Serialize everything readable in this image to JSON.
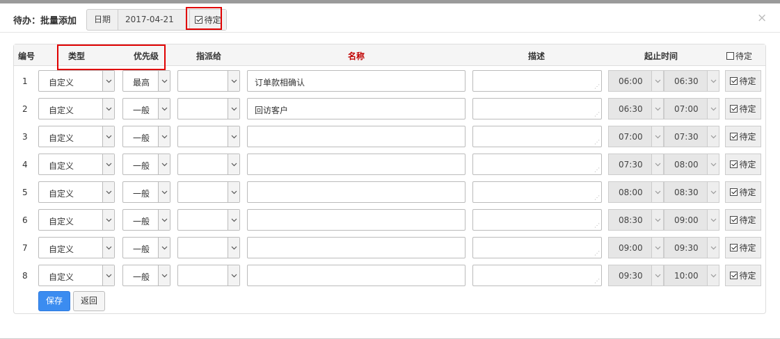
{
  "dialog": {
    "title": "待办：批量添加",
    "close": "×",
    "date_label": "日期",
    "date_value": "2017-04-21",
    "pending_label": "待定",
    "pending_checked": true
  },
  "table": {
    "headers": {
      "num": "编号",
      "type": "类型",
      "priority": "优先级",
      "assign": "指派给",
      "name": "名称",
      "desc": "描述",
      "time": "起止时间",
      "pending": "待定"
    },
    "rows": [
      {
        "num": "1",
        "type": "自定义",
        "priority": "最高",
        "assign": "",
        "name": "订单款相确认",
        "desc": "",
        "start": "06:00",
        "end": "06:30",
        "pending": "待定"
      },
      {
        "num": "2",
        "type": "自定义",
        "priority": "一般",
        "assign": "",
        "name": "回访客户",
        "desc": "",
        "start": "06:30",
        "end": "07:00",
        "pending": "待定"
      },
      {
        "num": "3",
        "type": "自定义",
        "priority": "一般",
        "assign": "",
        "name": "",
        "desc": "",
        "start": "07:00",
        "end": "07:30",
        "pending": "待定"
      },
      {
        "num": "4",
        "type": "自定义",
        "priority": "一般",
        "assign": "",
        "name": "",
        "desc": "",
        "start": "07:30",
        "end": "08:00",
        "pending": "待定"
      },
      {
        "num": "5",
        "type": "自定义",
        "priority": "一般",
        "assign": "",
        "name": "",
        "desc": "",
        "start": "08:00",
        "end": "08:30",
        "pending": "待定"
      },
      {
        "num": "6",
        "type": "自定义",
        "priority": "一般",
        "assign": "",
        "name": "",
        "desc": "",
        "start": "08:30",
        "end": "09:00",
        "pending": "待定"
      },
      {
        "num": "7",
        "type": "自定义",
        "priority": "一般",
        "assign": "",
        "name": "",
        "desc": "",
        "start": "09:00",
        "end": "09:30",
        "pending": "待定"
      },
      {
        "num": "8",
        "type": "自定义",
        "priority": "一般",
        "assign": "",
        "name": "",
        "desc": "",
        "start": "09:30",
        "end": "10:00",
        "pending": "待定"
      }
    ]
  },
  "buttons": {
    "save": "保存",
    "back": "返回"
  },
  "colors": {
    "highlight": "#e00000",
    "primary": "#3b8cf0",
    "name_header": "#c00000"
  }
}
